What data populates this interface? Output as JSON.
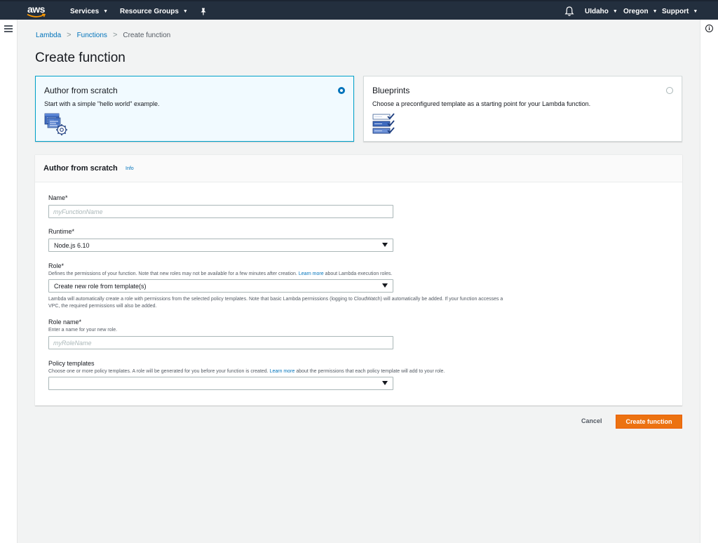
{
  "nav": {
    "logo_text": "aws",
    "services": "Services",
    "resource_groups": "Resource Groups",
    "user": "UIdaho",
    "region": "Oregon",
    "support": "Support"
  },
  "breadcrumb": {
    "lambda": "Lambda",
    "functions": "Functions",
    "current": "Create function",
    "separator": ">"
  },
  "page_title": "Create function",
  "tiles": {
    "author": {
      "title": "Author from scratch",
      "desc": "Start with a simple \"hello world\" example.",
      "selected": true
    },
    "blueprints": {
      "title": "Blueprints",
      "desc": "Choose a preconfigured template as a starting point for your Lambda function.",
      "selected": false
    }
  },
  "panel": {
    "title": "Author from scratch",
    "info": "Info",
    "name": {
      "label": "Name*",
      "placeholder": "myFunctionName",
      "value": ""
    },
    "runtime": {
      "label": "Runtime*",
      "value": "Node.js 6.10"
    },
    "role": {
      "label": "Role*",
      "desc_before": "Defines the permissions of your function. Note that new roles may not be available for a few minutes after creation.",
      "desc_link": "Learn more",
      "desc_after": "about Lambda execution roles.",
      "value": "Create new role from template(s)",
      "help": "Lambda will automatically create a role with permissions from the selected policy templates. Note that basic Lambda permissions (logging to CloudWatch) will automatically be added. If your function accesses a VPC, the required permissions will also be added."
    },
    "role_name": {
      "label": "Role name*",
      "desc": "Enter a name for your new role.",
      "placeholder": "myRoleName",
      "value": ""
    },
    "policy_templates": {
      "label": "Policy templates",
      "desc_before": "Choose one or more policy templates. A role will be generated for you before your function is created.",
      "desc_link": "Learn more",
      "desc_after": "about the permissions that each policy template will add to your role.",
      "value": ""
    }
  },
  "actions": {
    "cancel": "Cancel",
    "create": "Create function"
  },
  "colors": {
    "nav_bg": "#232f3e",
    "link": "#0073bb",
    "primary_button": "#ec7211",
    "selected_tile_border": "#00a1c9",
    "selected_tile_bg": "#f1faff"
  },
  "icons": {
    "bell": "bell-icon",
    "pin": "pin-icon",
    "menu": "hamburger-icon",
    "help": "info-icon",
    "author_tile": "code-gear-icon",
    "blueprints_tile": "checklist-icon"
  }
}
